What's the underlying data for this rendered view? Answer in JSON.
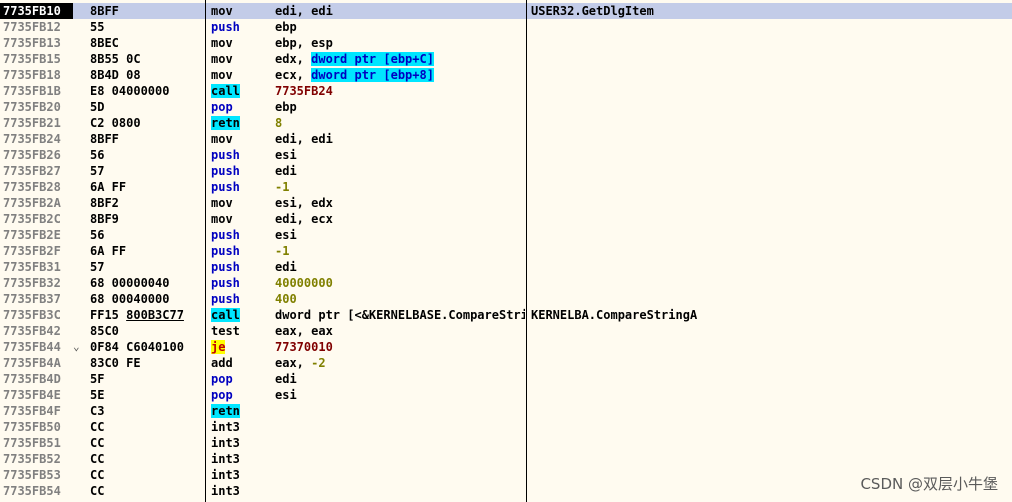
{
  "rows": [
    {
      "address": "7735FB10",
      "bytes": "8BFF",
      "mnemonic": "mov",
      "operands": "edi, edi",
      "comment": "USER32.GetDlgItem",
      "selected": true
    },
    {
      "address": "7735FB12",
      "bytes": "55",
      "mnemonic": "push",
      "operands": "ebp"
    },
    {
      "address": "7735FB13",
      "bytes": "8BEC",
      "mnemonic": "mov",
      "operands": "ebp, esp"
    },
    {
      "address": "7735FB15",
      "bytes": "8B55 0C",
      "mnemonic": "mov",
      "operands": "edx, ",
      "mem": "dword ptr [ebp+C]"
    },
    {
      "address": "7735FB18",
      "bytes": "8B4D 08",
      "mnemonic": "mov",
      "operands": "ecx, ",
      "mem": "dword ptr [ebp+8]"
    },
    {
      "address": "7735FB1B",
      "bytes": "E8 04000000",
      "mnemonic": "call",
      "operands": "7735FB24",
      "op_style": "addr"
    },
    {
      "address": "7735FB20",
      "bytes": "5D",
      "mnemonic": "pop",
      "operands": "ebp"
    },
    {
      "address": "7735FB21",
      "bytes": "C2 0800",
      "mnemonic": "retn",
      "operands": "8",
      "op_style": "num"
    },
    {
      "address": "7735FB24",
      "bytes": "8BFF",
      "mnemonic": "mov",
      "operands": "edi, edi"
    },
    {
      "address": "7735FB26",
      "bytes": "56",
      "mnemonic": "push",
      "operands": "esi"
    },
    {
      "address": "7735FB27",
      "bytes": "57",
      "mnemonic": "push",
      "operands": "edi"
    },
    {
      "address": "7735FB28",
      "bytes": "6A FF",
      "mnemonic": "push",
      "operands": "-1",
      "op_style": "num"
    },
    {
      "address": "7735FB2A",
      "bytes": "8BF2",
      "mnemonic": "mov",
      "operands": "esi, edx"
    },
    {
      "address": "7735FB2C",
      "bytes": "8BF9",
      "mnemonic": "mov",
      "operands": "edi, ecx"
    },
    {
      "address": "7735FB2E",
      "bytes": "56",
      "mnemonic": "push",
      "operands": "esi"
    },
    {
      "address": "7735FB2F",
      "bytes": "6A FF",
      "mnemonic": "push",
      "operands": "-1",
      "op_style": "num"
    },
    {
      "address": "7735FB31",
      "bytes": "57",
      "mnemonic": "push",
      "operands": "edi"
    },
    {
      "address": "7735FB32",
      "bytes": "68 00000040",
      "mnemonic": "push",
      "operands": "40000000",
      "op_style": "num"
    },
    {
      "address": "7735FB37",
      "bytes": "68 00040000",
      "mnemonic": "push",
      "operands": "400",
      "op_style": "num"
    },
    {
      "address": "7735FB3C",
      "bytes": "FF15",
      "bytes_ul": "800B3C77",
      "mnemonic": "call",
      "operands": "dword ptr [<&KERNELBASE.CompareStringA>]",
      "comment": "KERNELBA.CompareStringA"
    },
    {
      "address": "7735FB42",
      "bytes": "85C0",
      "mnemonic": "test",
      "operands": "eax, eax"
    },
    {
      "address": "7735FB44",
      "mark": "⌄",
      "bytes": "0F84 C6040100",
      "mnemonic": "je",
      "operands": "77370010",
      "op_style": "addr"
    },
    {
      "address": "7735FB4A",
      "bytes": "83C0 FE",
      "mnemonic": "add",
      "operands": "eax, ",
      "num_tail": "-2"
    },
    {
      "address": "7735FB4D",
      "bytes": "5F",
      "mnemonic": "pop",
      "operands": "edi"
    },
    {
      "address": "7735FB4E",
      "bytes": "5E",
      "mnemonic": "pop",
      "operands": "esi"
    },
    {
      "address": "7735FB4F",
      "bytes": "C3",
      "mnemonic": "retn",
      "operands": ""
    },
    {
      "address": "7735FB50",
      "bytes": "CC",
      "mnemonic": "int3",
      "operands": ""
    },
    {
      "address": "7735FB51",
      "bytes": "CC",
      "mnemonic": "int3",
      "operands": ""
    },
    {
      "address": "7735FB52",
      "bytes": "CC",
      "mnemonic": "int3",
      "operands": ""
    },
    {
      "address": "7735FB53",
      "bytes": "CC",
      "mnemonic": "int3",
      "operands": ""
    },
    {
      "address": "7735FB54",
      "bytes": "CC",
      "mnemonic": "int3",
      "operands": ""
    }
  ],
  "watermark": "CSDN @双层小牛堡",
  "colors": {
    "background": "#fffbf0",
    "selection": "#c3cce8",
    "call_retn_highlight": "#00e6ff",
    "jump_highlight": "#ffff00",
    "push_pop": "#0000c0",
    "address_operand": "#800000",
    "numeric_operand": "#808000"
  }
}
